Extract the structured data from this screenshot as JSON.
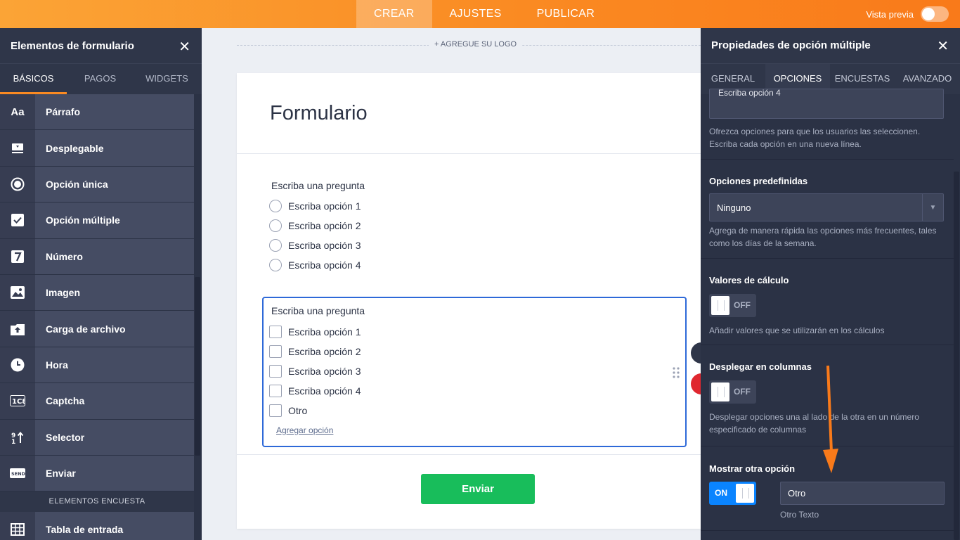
{
  "topbar": {
    "tabs": [
      "CREAR",
      "AJUSTES",
      "PUBLICAR"
    ],
    "active": "CREAR",
    "preview_label": "Vista previa"
  },
  "left_panel": {
    "title": "Elementos de formulario",
    "tabs": [
      "BÁSICOS",
      "PAGOS",
      "WIDGETS"
    ],
    "items": [
      {
        "label": "Párrafo",
        "icon": "paragraph-icon"
      },
      {
        "label": "Desplegable",
        "icon": "dropdown-icon"
      },
      {
        "label": "Opción única",
        "icon": "radio-icon"
      },
      {
        "label": "Opción múltiple",
        "icon": "checkbox-icon"
      },
      {
        "label": "Número",
        "icon": "number-icon"
      },
      {
        "label": "Imagen",
        "icon": "image-icon"
      },
      {
        "label": "Carga de archivo",
        "icon": "upload-icon"
      },
      {
        "label": "Hora",
        "icon": "clock-icon"
      },
      {
        "label": "Captcha",
        "icon": "captcha-icon"
      },
      {
        "label": "Selector",
        "icon": "spinner-icon"
      },
      {
        "label": "Enviar",
        "icon": "send-icon"
      }
    ],
    "section_label": "ELEMENTOS ENCUESTA",
    "section_items": [
      {
        "label": "Tabla de entrada",
        "icon": "table-icon"
      }
    ]
  },
  "canvas": {
    "logo_text": "+ AGREGUE SU LOGO",
    "form_title": "Formulario",
    "q1": {
      "label": "Escriba una pregunta",
      "options": [
        "Escriba opción 1",
        "Escriba opción 2",
        "Escriba opción 3",
        "Escriba opción 4"
      ]
    },
    "q2": {
      "label": "Escriba una pregunta",
      "options": [
        "Escriba opción 1",
        "Escriba opción 2",
        "Escriba opción 3",
        "Escriba opción 4",
        "Otro"
      ],
      "add_option": "Agregar opción"
    },
    "submit_label": "Enviar"
  },
  "right_panel": {
    "title": "Propiedades de opción múltiple",
    "tabs": [
      "GENERAL",
      "OPCIONES",
      "ENCUESTAS",
      "AVANZADO"
    ],
    "active_tab": "OPCIONES",
    "options_textarea_visible_text": "Escriba opción 4",
    "options_desc": "Ofrezca opciones para que los usuarios las seleccionen. Escriba cada opción en una nueva línea.",
    "predefined": {
      "title": "Opciones predefinidas",
      "value": "Ninguno",
      "desc": "Agrega de manera rápida las opciones más frecuentes, tales como los días de la semana."
    },
    "calc": {
      "title": "Valores de cálculo",
      "state": "OFF",
      "desc": "Añadir valores que se utilizarán en los cálculos"
    },
    "columns": {
      "title": "Desplegar en columnas",
      "state": "OFF",
      "desc": "Desplegar opciones una al lado de la otra en un número especificado de columnas"
    },
    "other": {
      "title": "Mostrar otra opción",
      "state": "ON",
      "input_value": "Otro",
      "input_label": "Otro Texto"
    }
  },
  "colors": {
    "accent": "#fa8a22",
    "panel": "#2b3245",
    "submit": "#18bd5b",
    "toggle_on": "#0a84ff",
    "annotation_arrow": "#f97a1a"
  }
}
